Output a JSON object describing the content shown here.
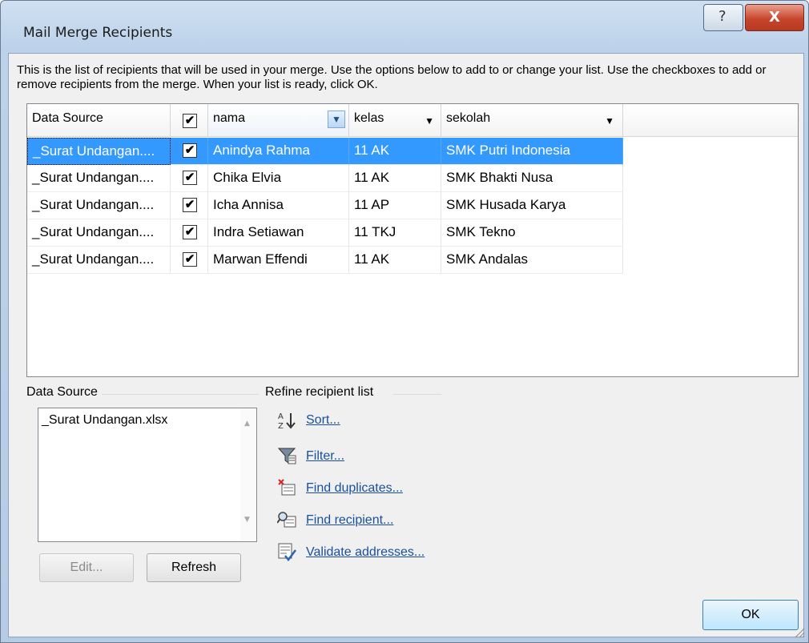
{
  "window": {
    "title": "Mail Merge Recipients",
    "help_glyph": "?",
    "close_glyph": "X"
  },
  "description": "This is the list of recipients that will be used in your merge.  Use the options below to add to or change your list.  Use the checkboxes to add or remove recipients from the merge.  When your list is ready, click OK.",
  "grid": {
    "headers": {
      "data_source": "Data Source",
      "nama": "nama",
      "kelas": "kelas",
      "sekolah": "sekolah"
    },
    "header_checked": true,
    "rows": [
      {
        "source": "_Surat Undangan....",
        "checked": true,
        "nama": "Anindya Rahma",
        "kelas": "11 AK",
        "sekolah": "SMK Putri Indonesia",
        "selected": true
      },
      {
        "source": "_Surat Undangan....",
        "checked": true,
        "nama": "Chika Elvia",
        "kelas": "11 AK",
        "sekolah": "SMK Bhakti Nusa",
        "selected": false
      },
      {
        "source": "_Surat Undangan....",
        "checked": true,
        "nama": "Icha Annisa",
        "kelas": "11 AP",
        "sekolah": "SMK Husada Karya",
        "selected": false
      },
      {
        "source": "_Surat Undangan....",
        "checked": true,
        "nama": "Indra Setiawan",
        "kelas": "11 TKJ",
        "sekolah": "SMK Tekno",
        "selected": false
      },
      {
        "source": "_Surat Undangan....",
        "checked": true,
        "nama": "Marwan Effendi",
        "kelas": "11 AK",
        "sekolah": "SMK Andalas",
        "selected": false
      }
    ],
    "selection_color": "#3399ff"
  },
  "data_source_panel": {
    "label": "Data Source",
    "items": [
      "_Surat Undangan.xlsx"
    ],
    "edit_label": "Edit...",
    "refresh_label": "Refresh"
  },
  "refine": {
    "label": "Refine recipient list",
    "sort": "Sort...",
    "filter": "Filter...",
    "find_duplicates": "Find duplicates...",
    "find_recipient": "Find recipient...",
    "validate": "Validate addresses..."
  },
  "ok_label": "OK",
  "colors": {
    "link": "#1a4f9c",
    "close": "#c8452c"
  }
}
